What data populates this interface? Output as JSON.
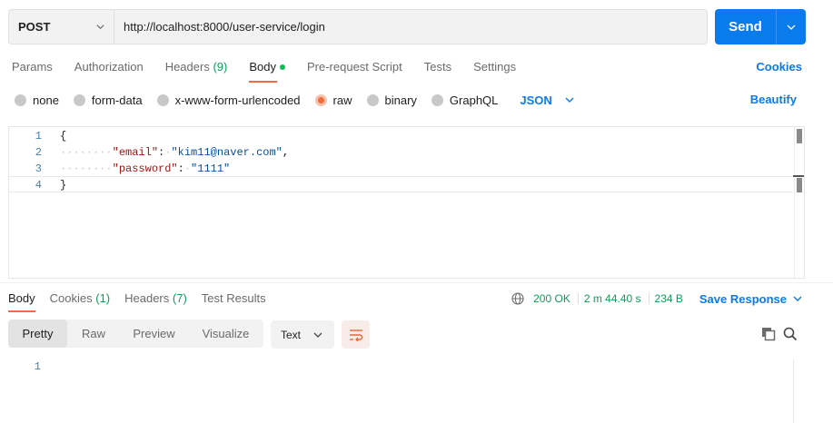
{
  "request": {
    "method": "POST",
    "url": "http://localhost:8000/user-service/login",
    "send_label": "Send"
  },
  "req_tabs": [
    {
      "label": "Params"
    },
    {
      "label": "Authorization"
    },
    {
      "label": "Headers",
      "count": "(9)"
    },
    {
      "label": "Body"
    },
    {
      "label": "Pre-request Script"
    },
    {
      "label": "Tests"
    },
    {
      "label": "Settings"
    }
  ],
  "cookies_label": "Cookies",
  "body_options": [
    "none",
    "form-data",
    "x-www-form-urlencoded",
    "raw",
    "binary",
    "GraphQL"
  ],
  "body_selected": "raw",
  "language": "JSON",
  "beautify_label": "Beautify",
  "editor": {
    "line_numbers": [
      "1",
      "2",
      "3",
      "4"
    ],
    "open_brace": "{",
    "close_brace": "}",
    "email_key": "\"email\"",
    "email_value": "\"kim11@naver.com\"",
    "password_key": "\"password\"",
    "password_value": "\"1111\""
  },
  "resp_tabs": [
    {
      "label": "Body"
    },
    {
      "label": "Cookies",
      "count": "(1)"
    },
    {
      "label": "Headers",
      "count": "(7)"
    },
    {
      "label": "Test Results"
    }
  ],
  "status": {
    "code": "200 OK",
    "time": "2 m 44.40 s",
    "size": "234 B",
    "save_label": "Save Response"
  },
  "view_modes": [
    "Pretty",
    "Raw",
    "Preview",
    "Visualize"
  ],
  "view_active": "Pretty",
  "format": "Text",
  "response": {
    "line_numbers": [
      "1"
    ]
  },
  "colors": {
    "accent": "#097bed",
    "active_tab": "#f26b3a",
    "success": "#0f9d58"
  },
  "icons": [
    "chevron-down-icon",
    "globe-icon",
    "wrap-icon",
    "copy-icon",
    "search-icon"
  ]
}
